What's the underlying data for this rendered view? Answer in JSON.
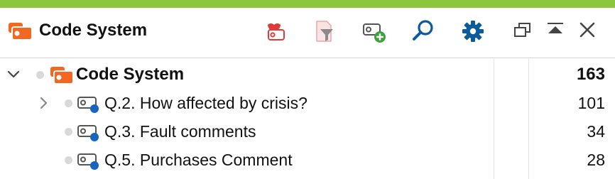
{
  "colors": {
    "accent_bar": "#8cc63f",
    "brand_orange": "#f26722",
    "code_blue": "#1565c0",
    "toolbar_blue": "#0b5a9c",
    "toolbar_red": "#e03b3b"
  },
  "header": {
    "title": "Code System",
    "icon": "code-system-icon",
    "toolbar": [
      {
        "name": "activate-codes-icon",
        "tooltip": ""
      },
      {
        "name": "filter-icon",
        "tooltip": ""
      },
      {
        "name": "new-code-icon",
        "tooltip": ""
      },
      {
        "name": "search-icon",
        "tooltip": ""
      },
      {
        "name": "gear-icon",
        "tooltip": ""
      }
    ],
    "window_controls": [
      {
        "name": "undock-icon"
      },
      {
        "name": "collapse-icon"
      },
      {
        "name": "close-icon"
      }
    ]
  },
  "tree": {
    "root": {
      "label": "Code System",
      "count": "163",
      "expanded": true
    },
    "items": [
      {
        "label": "Q.2. How affected by crisis?",
        "count": "101",
        "has_children": true,
        "expanded": false
      },
      {
        "label": "Q.3. Fault comments",
        "count": "34",
        "has_children": false
      },
      {
        "label": "Q.5. Purchases Comment",
        "count": "28",
        "has_children": false
      }
    ]
  }
}
